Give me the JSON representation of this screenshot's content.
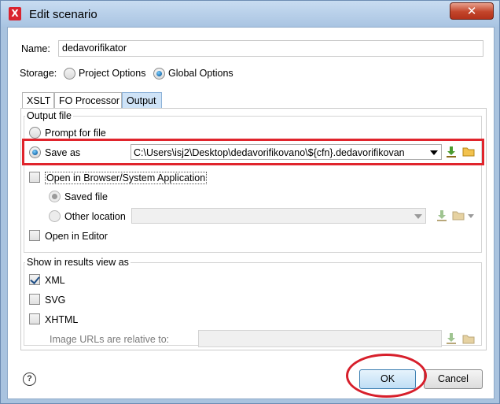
{
  "window": {
    "title": "Edit scenario",
    "app_icon_glyph": "X",
    "close_glyph": "✕"
  },
  "name_row": {
    "label": "Name:",
    "value": "dedavorifikator"
  },
  "storage": {
    "label": "Storage:",
    "options": [
      {
        "label": "Project Options",
        "checked": false
      },
      {
        "label": "Global Options",
        "checked": true
      }
    ]
  },
  "tabs": [
    {
      "label": "XSLT",
      "active": false
    },
    {
      "label": "FO Processor",
      "active": false
    },
    {
      "label": "Output",
      "active": true
    }
  ],
  "output_file": {
    "title": "Output file",
    "prompt_label": "Prompt for file",
    "save_as_label": "Save as",
    "save_as_value": "C:\\Users\\isj2\\Desktop\\dedavorifikovano\\${cfn}.dedavorifikovan",
    "open_browser_label": "Open in Browser/System Application",
    "saved_file_label": "Saved file",
    "other_location_label": "Other location",
    "open_editor_label": "Open in Editor"
  },
  "results_view": {
    "title": "Show in results view as",
    "xml_label": "XML",
    "svg_label": "SVG",
    "xhtml_label": "XHTML",
    "image_urls_label": "Image URLs are relative to:"
  },
  "buttons": {
    "ok": "OK",
    "cancel": "Cancel",
    "help_glyph": "?"
  },
  "colors": {
    "highlight": "#e0242c",
    "accent": "#3c7fb1",
    "tab_active": "#cfe3f7"
  }
}
